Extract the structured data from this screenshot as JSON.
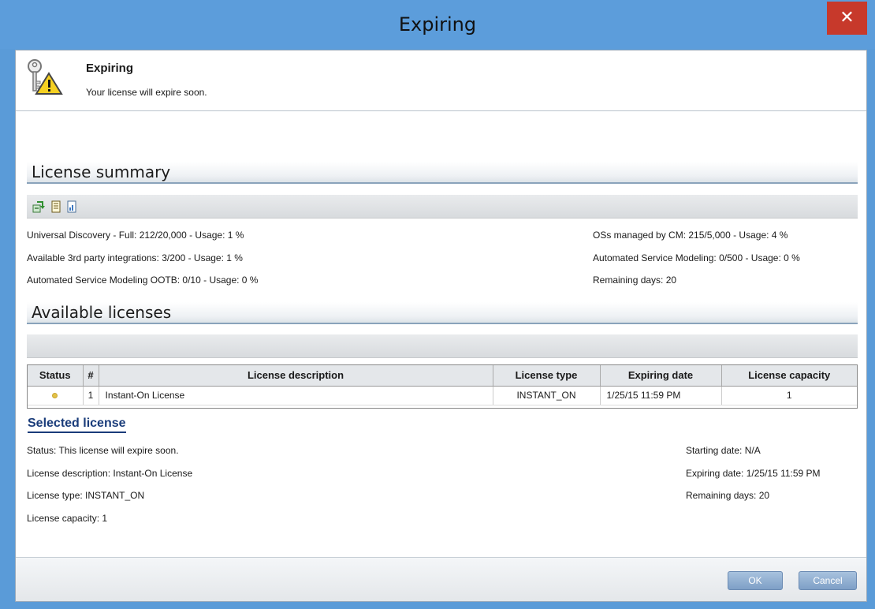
{
  "window": {
    "title": "Expiring",
    "close_glyph": "✕"
  },
  "header": {
    "title": "Expiring",
    "subtitle": "Your license will expire soon.",
    "icon": "key-warning-icon"
  },
  "license_summary": {
    "title": "License summary",
    "toolbar_icons": [
      "refresh-icon",
      "document-icon",
      "report-icon"
    ],
    "left": [
      "Universal Discovery - Full: 212/20,000 - Usage: 1 %",
      "Available 3rd party integrations: 3/200 - Usage: 1 %",
      "Automated Service Modeling OOTB: 0/10 - Usage: 0 %"
    ],
    "right": [
      "OSs managed by CM: 215/5,000 - Usage: 4 %",
      "Automated Service Modeling: 0/500 - Usage: 0 %",
      "Remaining days: 20"
    ]
  },
  "available_licenses": {
    "title": "Available licenses",
    "columns": [
      "Status",
      "#",
      "License description",
      "License type",
      "Expiring date",
      "License capacity"
    ],
    "rows": [
      {
        "status_color": "#e3c248",
        "num": "1",
        "description": "Instant-On License",
        "type": "INSTANT_ON",
        "expiring": "1/25/15 11:59 PM",
        "capacity": "1"
      }
    ]
  },
  "selected_license": {
    "title": "Selected license",
    "left": [
      "Status: This license will expire soon.",
      "License description: Instant-On License",
      "License type: INSTANT_ON",
      "License capacity: 1"
    ],
    "right": [
      "Starting date: N/A",
      "Expiring date: 1/25/15 11:59 PM",
      "Remaining days: 20"
    ]
  },
  "buttons": {
    "ok": "OK",
    "cancel": "Cancel"
  },
  "colors": {
    "titlebar": "#5c9ddb",
    "close": "#c7392b",
    "accent": "#1a3c7a"
  }
}
